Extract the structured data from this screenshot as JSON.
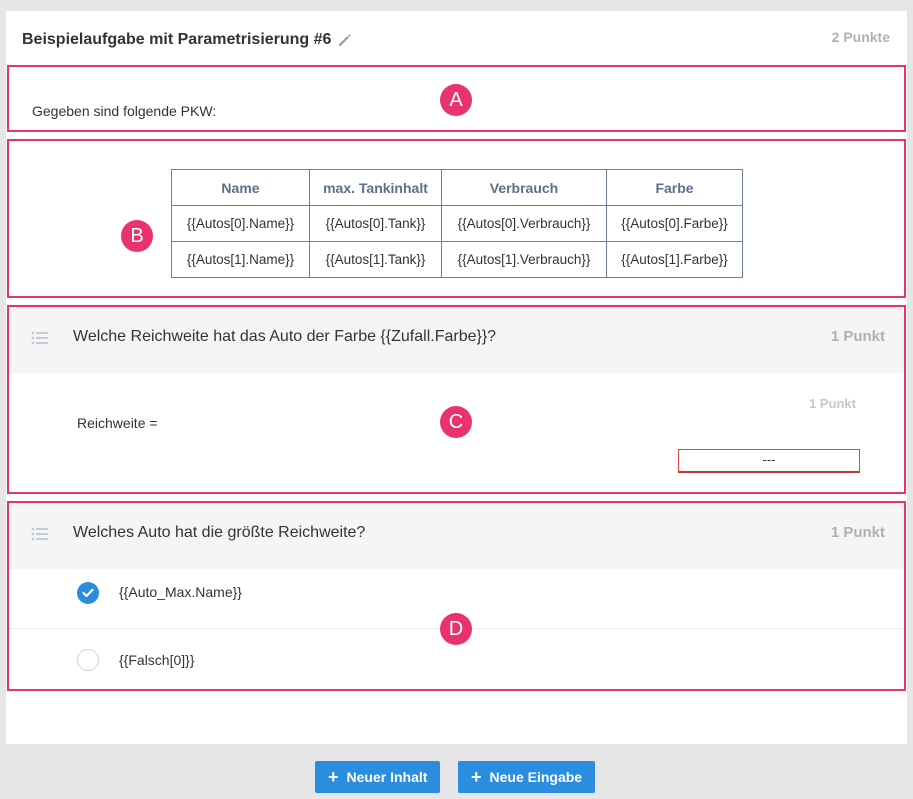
{
  "task": {
    "title": "Beispielaufgabe mit Parametrisierung #6",
    "points": "2 Punkte"
  },
  "markers": {
    "a": "A",
    "b": "B",
    "c": "C",
    "d": "D"
  },
  "section_a": {
    "text": "Gegeben sind folgende PKW:"
  },
  "section_b": {
    "headers": [
      "Name",
      "max. Tankinhalt",
      "Verbrauch",
      "Farbe"
    ],
    "rows": [
      [
        "{{Autos[0].Name}}",
        "{{Autos[0].Tank}}",
        "{{Autos[0].Verbrauch}}",
        "{{Autos[0].Farbe}}"
      ],
      [
        "{{Autos[1].Name}}",
        "{{Autos[1].Tank}}",
        "{{Autos[1].Verbrauch}}",
        "{{Autos[1].Farbe}}"
      ]
    ]
  },
  "section_c": {
    "question": "Welche Reichweite hat das Auto der Farbe {{Zufall.Farbe}}?",
    "points": "1 Punkt",
    "field_label": "Reichweite =",
    "field_points": "1 Punkt",
    "field_value": "---"
  },
  "section_d": {
    "question": "Welches Auto hat die größte Reichweite?",
    "points": "1 Punkt",
    "options": [
      {
        "label": "{{Auto_Max.Name}}",
        "checked": true
      },
      {
        "label": "{{Falsch[0]}}",
        "checked": false
      }
    ]
  },
  "buttons": {
    "new_content": "Neuer Inhalt",
    "new_input": "Neue Eingabe"
  },
  "icons": {
    "edit": "pencil-icon",
    "question_list": "list-icon",
    "checked": "checkmark-icon",
    "add": "plus-icon"
  },
  "colors": {
    "highlight_border": "#e8336d",
    "primary": "#2b8de0",
    "muted_points": "#b0b0b0"
  }
}
